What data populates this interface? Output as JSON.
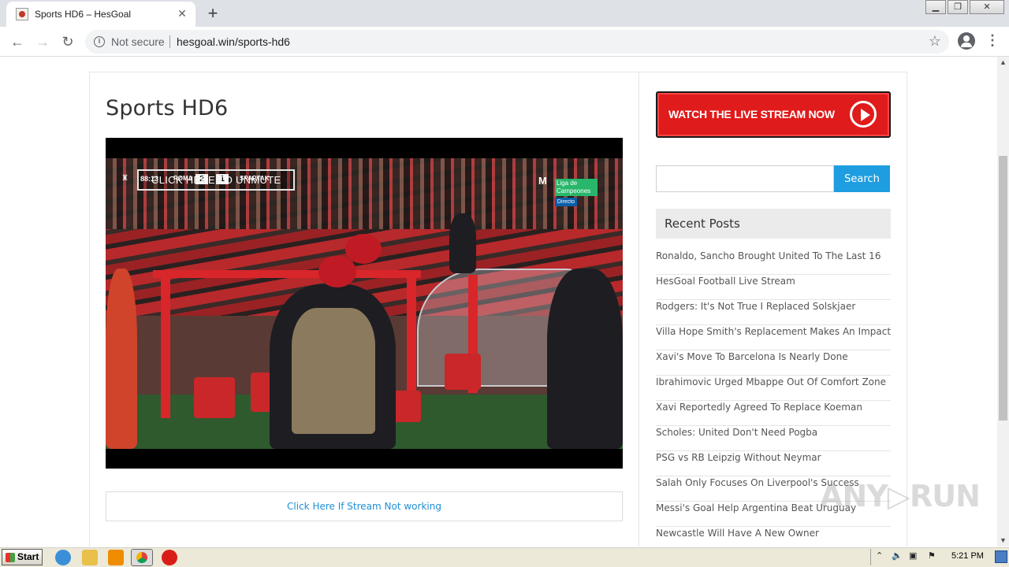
{
  "browser": {
    "tab_title": "Sports HD6 – HesGoal",
    "tab_close": "✕",
    "new_tab": "+",
    "omnibox": {
      "security_label": "Not secure",
      "url": "hesgoal.win/sports-hd6"
    }
  },
  "page": {
    "title": "Sports HD6",
    "player": {
      "overlay_label": "CLICK HERE TO UNMUTE",
      "match_time": "88:13",
      "team_left": "ROMA",
      "score_left": "2",
      "score_right": "1",
      "team_right": "SPARTAK",
      "channel_logo": "M",
      "league_badge": "Liga de Campeones",
      "live_tag": "Directo"
    },
    "stream_link": "Click Here If Stream Not working"
  },
  "sidebar": {
    "banner_label": "WATCH THE LIVE STREAM NOW",
    "search": {
      "placeholder": "",
      "button_label": "Search"
    },
    "recent_posts_title": "Recent Posts",
    "recent_posts": [
      "Ronaldo, Sancho Brought United To The Last 16",
      "HesGoal Football Live Stream",
      "Rodgers: It's Not True I Replaced Solskjaer",
      "Villa Hope Smith's Replacement Makes An Impact",
      "Xavi's Move To Barcelona Is Nearly Done",
      "Ibrahimovic Urged Mbappe Out Of Comfort Zone",
      "Xavi Reportedly Agreed To Replace Koeman",
      "Scholes: United Don't Need Pogba",
      "PSG vs RB Leipzig Without Neymar",
      "Salah Only Focuses On Liverpool's Success",
      "Messi's Goal Help Argentina Beat Uruguay",
      "Newcastle Will Have A New Owner"
    ]
  },
  "watermark": "ANY▷RUN",
  "taskbar": {
    "start_label": "Start",
    "clock": "5:21 PM"
  },
  "colors": {
    "accent_blue": "#1e9ee0",
    "banner_red": "#e01b1b",
    "link_blue": "#1e8fd6"
  }
}
